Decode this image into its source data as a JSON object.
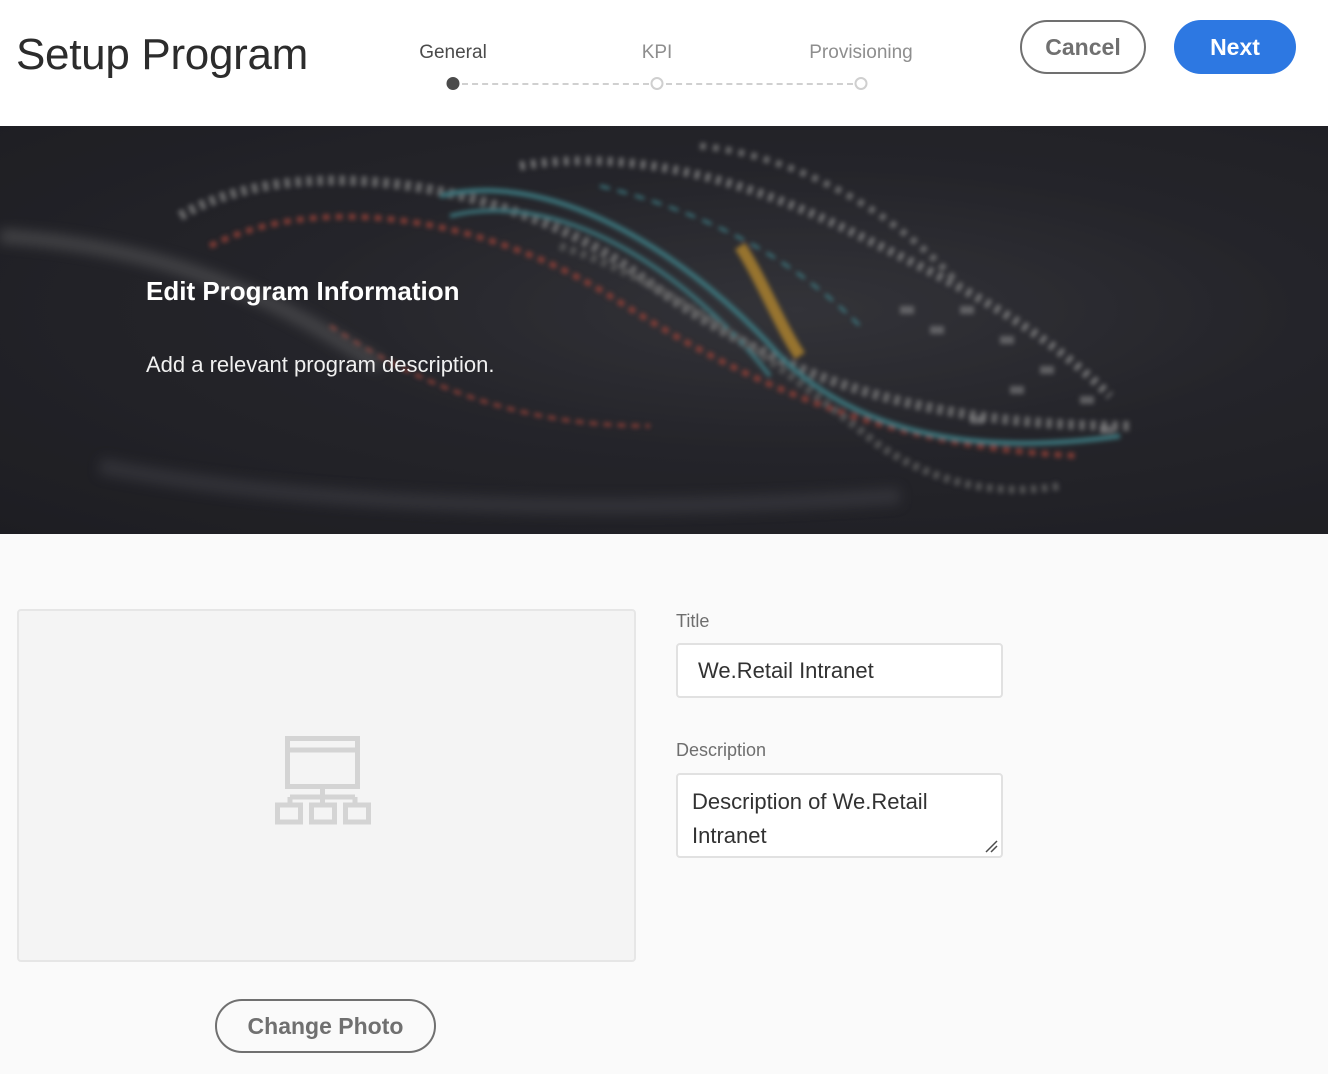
{
  "header": {
    "title": "Setup Program",
    "cancel_label": "Cancel",
    "next_label": "Next"
  },
  "wizard": {
    "steps": [
      {
        "label": "General",
        "active": true
      },
      {
        "label": "KPI",
        "active": false
      },
      {
        "label": "Provisioning",
        "active": false
      }
    ]
  },
  "banner": {
    "title": "Edit Program Information",
    "subtitle": "Add a relevant program description."
  },
  "form": {
    "title_label": "Title",
    "title_value": "We.Retail Intranet",
    "description_label": "Description",
    "description_value": "Description of We.Retail Intranet"
  },
  "photo": {
    "icon": "sitemap-icon",
    "change_label": "Change Photo"
  },
  "colors": {
    "accent": "#2d78e2",
    "banner_bg": "#26262c"
  }
}
